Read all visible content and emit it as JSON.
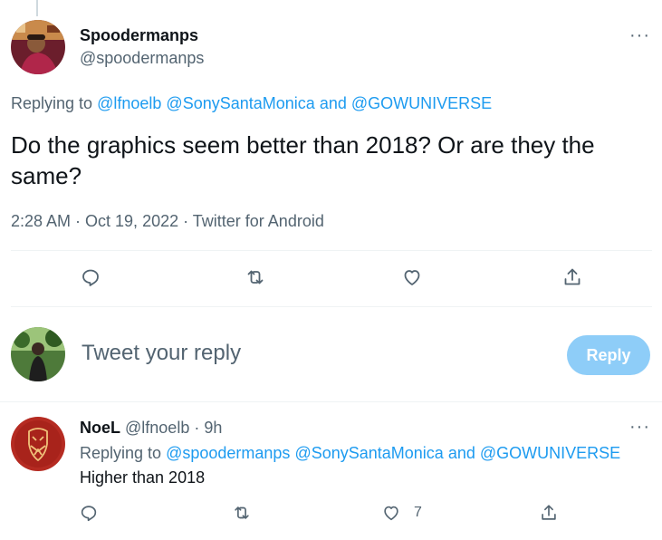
{
  "main_tweet": {
    "display_name": "Spoodermanps",
    "handle": "@spoodermanps",
    "replying_prefix": "Replying to",
    "replying_to": [
      "@lfnoelb",
      "@SonySantaMonica"
    ],
    "replying_and": "and",
    "replying_last": "@GOWUNIVERSE",
    "text": "Do the graphics seem better than 2018? Or are they the same?",
    "meta": "2:28 AM · Oct 19, 2022 · Twitter for Android",
    "more": "···"
  },
  "compose": {
    "placeholder": "Tweet your reply",
    "button_label": "Reply"
  },
  "reply_tweet": {
    "display_name": "NoeL",
    "handle": "@lfnoelb",
    "separator": "·",
    "time": "9h",
    "replying_prefix": "Replying to",
    "replying_to": [
      "@spoodermanps",
      "@SonySantaMonica"
    ],
    "replying_and": "and",
    "replying_last": "@GOWUNIVERSE",
    "text": "Higher than 2018",
    "like_count": "7",
    "more": "···"
  },
  "colors": {
    "accent": "#1d9bf0",
    "reply_button": "#8ecdf8",
    "secondary_text": "#536471"
  },
  "icons": [
    "reply-icon",
    "retweet-icon",
    "like-icon",
    "share-icon",
    "more-icon"
  ]
}
